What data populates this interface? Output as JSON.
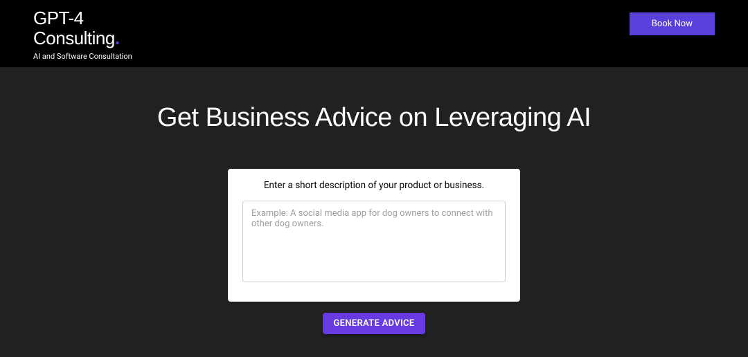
{
  "header": {
    "brand_line1": "GPT-4",
    "brand_line2": "Consulting",
    "brand_dot": ".",
    "tagline": "AI and Software Consultation",
    "book_now_label": "Book Now"
  },
  "main": {
    "title": "Get Business Advice on Leveraging AI",
    "form_label": "Enter a short description of your product or business.",
    "textarea_placeholder": "Example: A social media app for dog owners to connect with other dog owners.",
    "textarea_value": "",
    "generate_label": "GENERATE ADVICE"
  },
  "colors": {
    "accent": "#5B3FDC",
    "generate": "#673AE2",
    "bg": "#212121",
    "header_bg": "#000000"
  }
}
